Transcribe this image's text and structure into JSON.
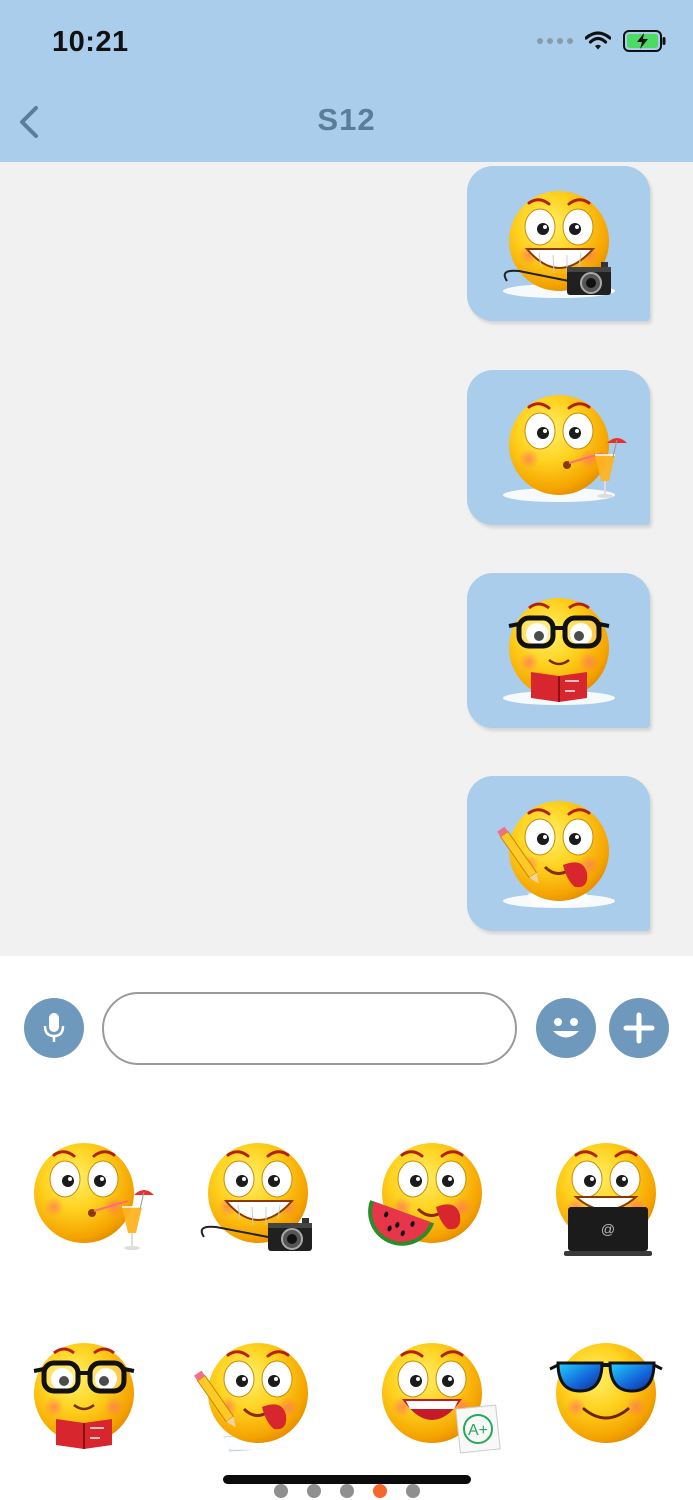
{
  "status_bar": {
    "time": "10:21",
    "battery_color": "#4cd964",
    "icons": [
      "signal-dots-icon",
      "wifi-icon",
      "battery-charging-icon"
    ]
  },
  "header": {
    "title": "S12",
    "back_icon": "chevron-left-icon",
    "background": "#a9cdea"
  },
  "messages": [
    {
      "sticker": "emoji-grin-camera"
    },
    {
      "sticker": "emoji-drink-cocktail"
    },
    {
      "sticker": "emoji-nerd-reading-book"
    },
    {
      "sticker": "emoji-writing-pencil-tongue"
    }
  ],
  "composer": {
    "input_value": "",
    "input_placeholder": "",
    "mic_icon": "microphone-icon",
    "emoji_icon": "smiley-icon",
    "add_icon": "plus-icon",
    "button_color": "#6f98bd"
  },
  "sticker_grid": [
    {
      "sticker": "emoji-drink-cocktail"
    },
    {
      "sticker": "emoji-grin-camera"
    },
    {
      "sticker": "emoji-watermelon-tongue"
    },
    {
      "sticker": "emoji-grin-laptop"
    },
    {
      "sticker": "emoji-nerd-reading-book"
    },
    {
      "sticker": "emoji-writing-pencil-tongue"
    },
    {
      "sticker": "emoji-laugh-grade-a-plus"
    },
    {
      "sticker": "emoji-sunglasses-smile"
    }
  ],
  "grid_labels": {
    "laptop_symbol": "@",
    "grade_text": "A+"
  },
  "pager": {
    "count": 5,
    "active_index": 3,
    "active_color": "#f4692a"
  }
}
